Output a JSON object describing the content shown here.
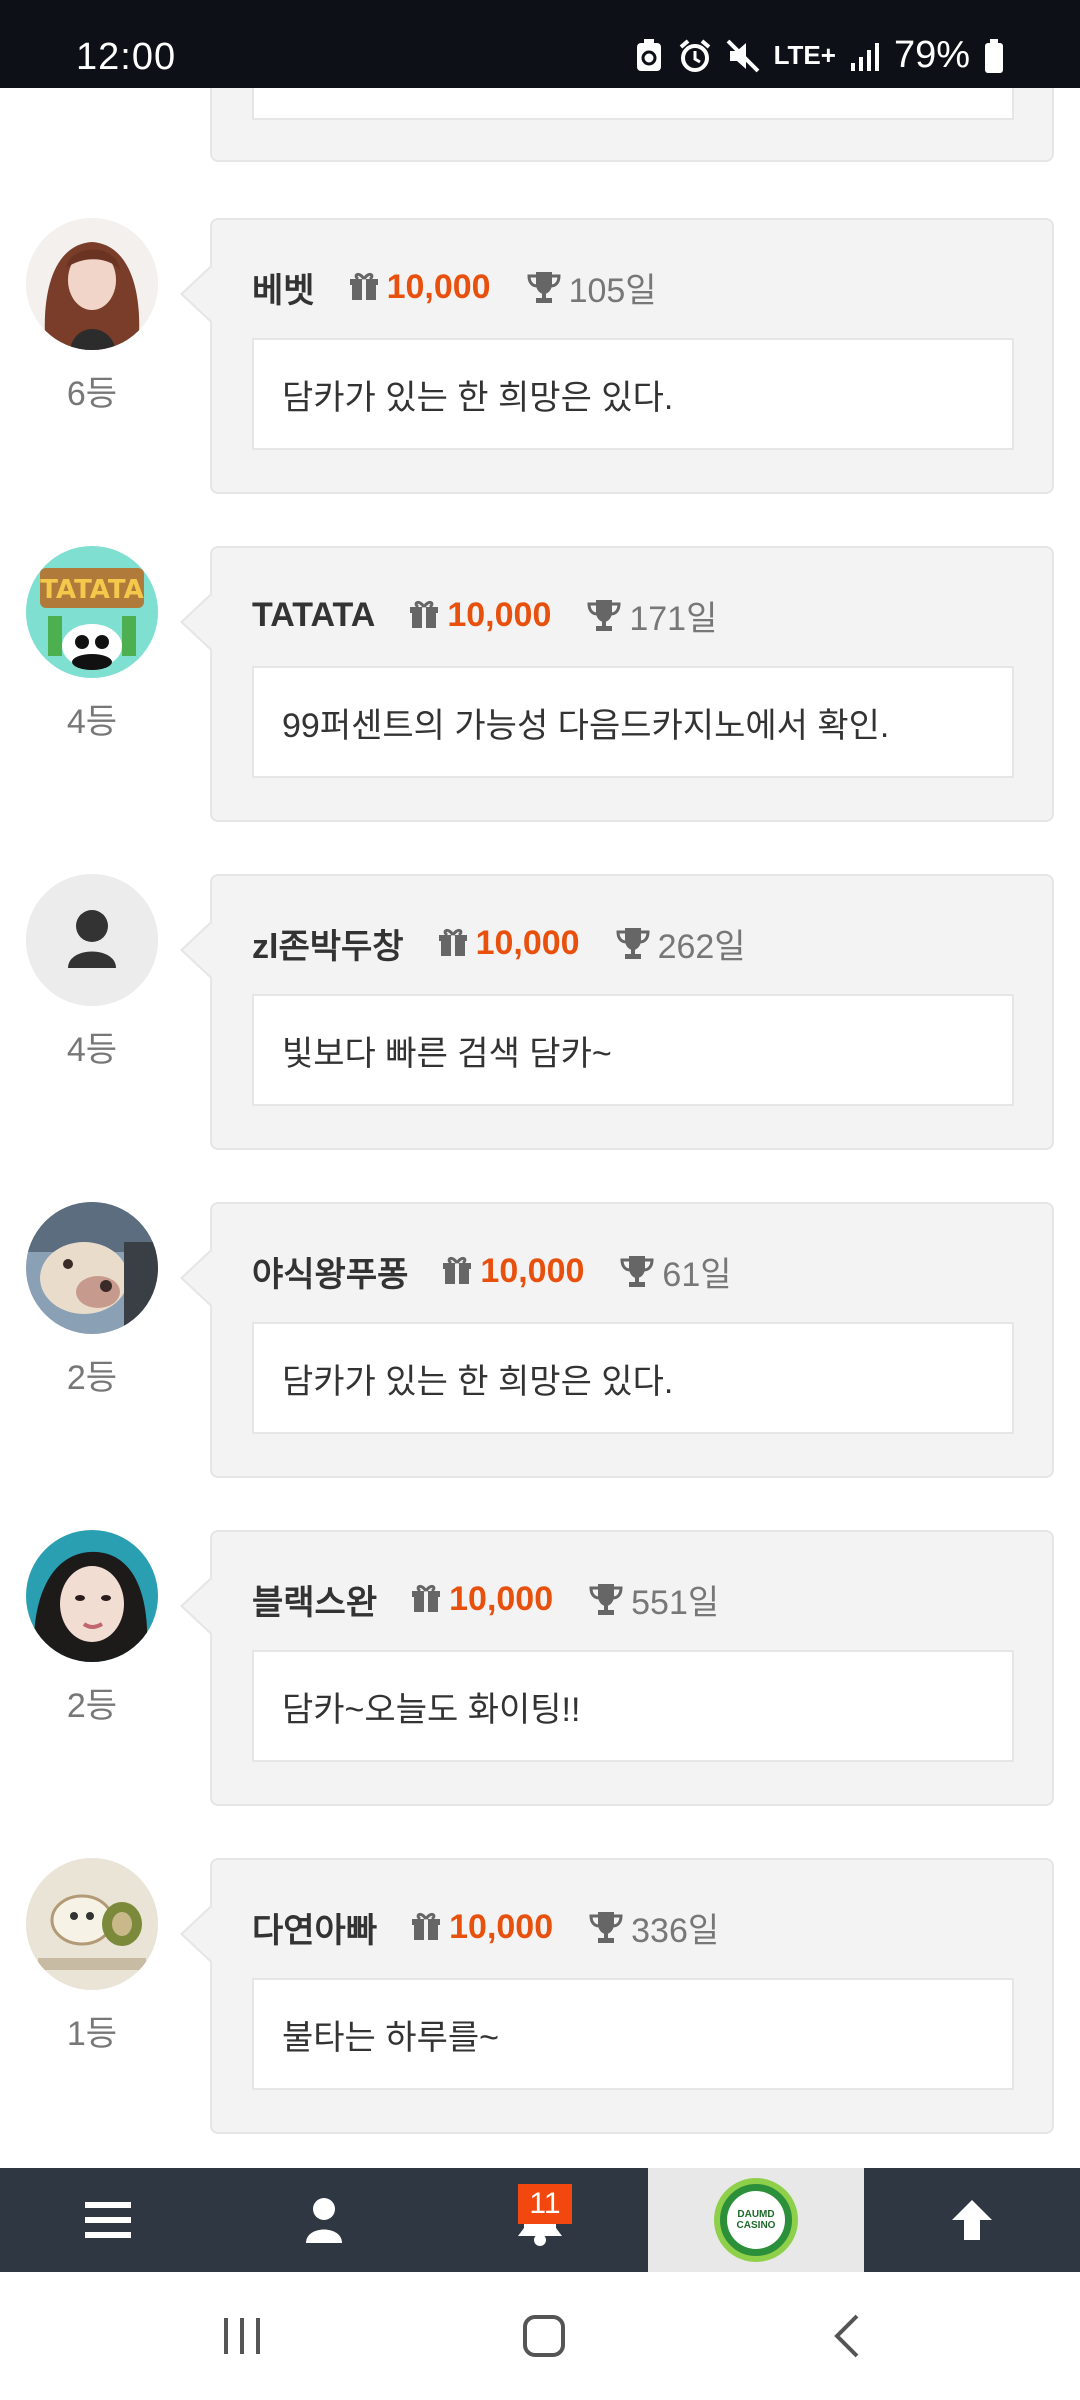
{
  "status_bar": {
    "time": "12:00",
    "network": "LTE+",
    "battery": "79%"
  },
  "entries": [
    {
      "nickname": "베벳",
      "points": "10,000",
      "days": "105일",
      "rank": "6등",
      "message": "담카가 있는 한 희망은 있다.",
      "avatar": "woman-photo"
    },
    {
      "nickname": "TATATA",
      "points": "10,000",
      "days": "171일",
      "rank": "4등",
      "message": "99퍼센트의 가능성 다음드카지노에서 확인.",
      "avatar": "panda-tatata"
    },
    {
      "nickname": "zl존박두창",
      "points": "10,000",
      "days": "262일",
      "rank": "4등",
      "message": "빛보다 빠른 검색 담카~",
      "avatar": "default-user"
    },
    {
      "nickname": "야식왕푸퐁",
      "points": "10,000",
      "days": "61일",
      "rank": "2등",
      "message": "담카가 있는 한 희망은 있다.",
      "avatar": "dog-photo"
    },
    {
      "nickname": "블랙스완",
      "points": "10,000",
      "days": "551일",
      "rank": "2등",
      "message": "담카~오늘도 화이팅!!",
      "avatar": "girl-photo"
    },
    {
      "nickname": "다연아빠",
      "points": "10,000",
      "days": "336일",
      "rank": "1등",
      "message": "불타는 하루를~",
      "avatar": "hamster-drawing"
    }
  ],
  "bottom_nav": {
    "notification_count": "11",
    "logo_line1": "DAUMD",
    "logo_line2": "CASINO"
  },
  "colors": {
    "accent_points": "#e8500e",
    "nav_bg": "#2f3743",
    "badge": "#f2470f"
  }
}
